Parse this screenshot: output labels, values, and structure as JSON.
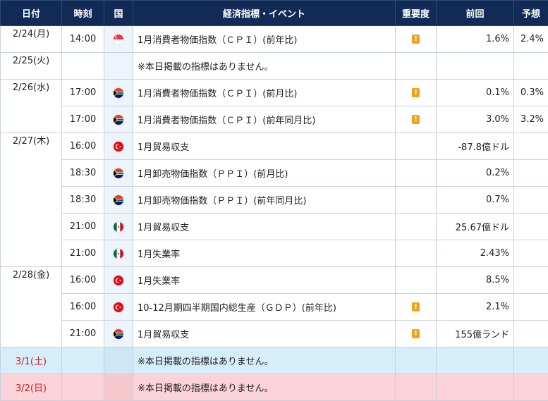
{
  "header": {
    "date": "日付",
    "time": "時刻",
    "country": "国",
    "event": "経済指標・イベント",
    "importance": "重要度",
    "previous": "前回",
    "forecast": "予想"
  },
  "rows": [
    {
      "date": "2/24(月)",
      "time": "14:00",
      "country": "singapore-flag",
      "event": "1月消費者物価指数（ＣＰＩ）(前年比)",
      "importance": "!",
      "previous": "1.6%",
      "forecast": "2.4%"
    },
    {
      "date": "2/25(火)",
      "time": "",
      "country": "",
      "event": "※本日掲載の指標はありません。",
      "importance": "",
      "previous": "",
      "forecast": ""
    },
    {
      "date": "2/26(水)",
      "time": "17:00",
      "country": "south-africa-flag",
      "event": "1月消費者物価指数（ＣＰＩ）(前月比)",
      "importance": "!",
      "previous": "0.1%",
      "forecast": "0.3%"
    },
    {
      "date": "",
      "time": "17:00",
      "country": "south-africa-flag",
      "event": "1月消費者物価指数（ＣＰＩ）(前年同月比)",
      "importance": "!",
      "previous": "3.0%",
      "forecast": "3.2%"
    },
    {
      "date": "2/27(木)",
      "time": "16:00",
      "country": "turkey-flag",
      "event": "1月貿易収支",
      "importance": "",
      "previous": "-87.8億ドル",
      "forecast": ""
    },
    {
      "date": "",
      "time": "18:30",
      "country": "south-africa-flag",
      "event": "1月卸売物価指数（ＰＰＩ）(前月比)",
      "importance": "",
      "previous": "0.2%",
      "forecast": ""
    },
    {
      "date": "",
      "time": "18:30",
      "country": "south-africa-flag",
      "event": "1月卸売物価指数（ＰＰＩ）(前年同月比)",
      "importance": "",
      "previous": "0.7%",
      "forecast": ""
    },
    {
      "date": "",
      "time": "21:00",
      "country": "mexico-flag",
      "event": "1月貿易収支",
      "importance": "",
      "previous": "25.67億ドル",
      "forecast": ""
    },
    {
      "date": "",
      "time": "21:00",
      "country": "mexico-flag",
      "event": "1月失業率",
      "importance": "",
      "previous": "2.43%",
      "forecast": ""
    },
    {
      "date": "2/28(金)",
      "time": "16:00",
      "country": "turkey-flag",
      "event": "1月失業率",
      "importance": "",
      "previous": "8.5%",
      "forecast": ""
    },
    {
      "date": "",
      "time": "16:00",
      "country": "turkey-flag",
      "event": "10-12月期四半期国内総生産（ＧＤＰ）(前年比)",
      "importance": "!",
      "previous": "2.1%",
      "forecast": ""
    },
    {
      "date": "",
      "time": "21:00",
      "country": "south-africa-flag",
      "event": "1月貿易収支",
      "importance": "!",
      "previous": "155億ランド",
      "forecast": ""
    },
    {
      "date": "3/1(土)",
      "time": "",
      "country": "",
      "event": "※本日掲載の指標はありません。",
      "importance": "",
      "previous": "",
      "forecast": "",
      "day_type": "saturday"
    },
    {
      "date": "3/2(日)",
      "time": "",
      "country": "",
      "event": "※本日掲載の指標はありません。",
      "importance": "",
      "previous": "",
      "forecast": "",
      "day_type": "sunday"
    }
  ],
  "colors": {
    "header_bg": "#112a56",
    "importance_badge": "#f0a21a",
    "weekend_text": "#d0201e",
    "saturday_bg": "#d6eef9",
    "sunday_bg": "#fbd3d8"
  }
}
